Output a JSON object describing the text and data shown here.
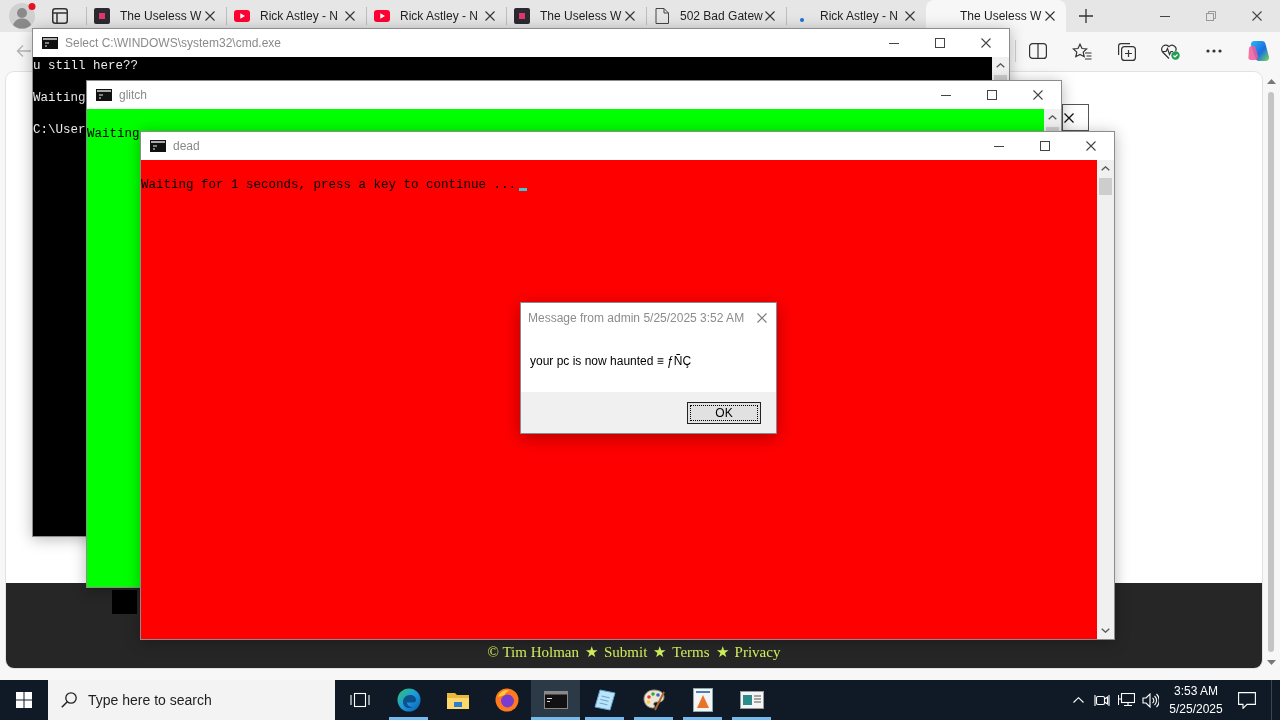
{
  "browser": {
    "tabs": [
      {
        "title": "The Useless W",
        "kind": "square",
        "selected": false
      },
      {
        "title": "Rick Astley - N",
        "kind": "play",
        "selected": false
      },
      {
        "title": "Rick Astley - N",
        "kind": "play",
        "selected": false
      },
      {
        "title": "The Useless W",
        "kind": "square",
        "selected": false
      },
      {
        "title": "502 Bad Gatew",
        "kind": "document",
        "selected": false
      },
      {
        "title": "Rick Astley - N",
        "kind": "dot",
        "selected": false
      },
      {
        "title": "The Useless W",
        "kind": "blank",
        "selected": true
      }
    ],
    "page": {
      "footer": {
        "items": [
          "© Tim Holman",
          "Submit",
          "Terms",
          "Privacy"
        ],
        "separators": [
          "★",
          "★",
          "★"
        ]
      }
    }
  },
  "windows": [
    {
      "title": "Select C:\\WINDOWS\\system32\\cmd.exe",
      "color": "#000000",
      "lines": [
        {
          "kind": "echo",
          "text": "u still here??"
        },
        {
          "kind": "timeout",
          "text": "Waiting"
        },
        {
          "kind": "prompt",
          "text": "C:\\User"
        }
      ]
    },
    {
      "title": "glitch",
      "color": "#00ff00",
      "lines": [
        {
          "kind": "timeout",
          "text": "Waiting"
        }
      ]
    },
    {
      "title": "dead",
      "color": "#ff0000",
      "cursor": true,
      "lines": [
        {
          "kind": "timeout",
          "text": "Waiting for 1 seconds, press a key to continue ..."
        }
      ]
    }
  ],
  "message_box": {
    "title": "Message from admin 5/25/2025 3:52 AM",
    "message": "your pc is now haunted ≡ ƒÑÇ",
    "buttons": [
      {
        "label": "OK",
        "focused": true
      }
    ]
  },
  "taskbar": {
    "search": {
      "placeholder": "Type here to search"
    },
    "apps": [
      {
        "kind": "task-view",
        "running": false,
        "selected": false
      },
      {
        "kind": "edge",
        "running": true,
        "selected": false
      },
      {
        "kind": "explorer",
        "running": false,
        "selected": false
      },
      {
        "kind": "firefox",
        "running": false,
        "selected": false
      },
      {
        "kind": "terminal",
        "running": true,
        "selected": true
      },
      {
        "kind": "notepad",
        "running": true,
        "selected": false
      },
      {
        "kind": "paint",
        "running": true,
        "selected": false
      },
      {
        "kind": "document",
        "running": true,
        "selected": false
      },
      {
        "kind": "window",
        "running": true,
        "selected": false
      }
    ],
    "clock": {
      "time": "3:53 AM",
      "date": "5/25/2025"
    }
  }
}
